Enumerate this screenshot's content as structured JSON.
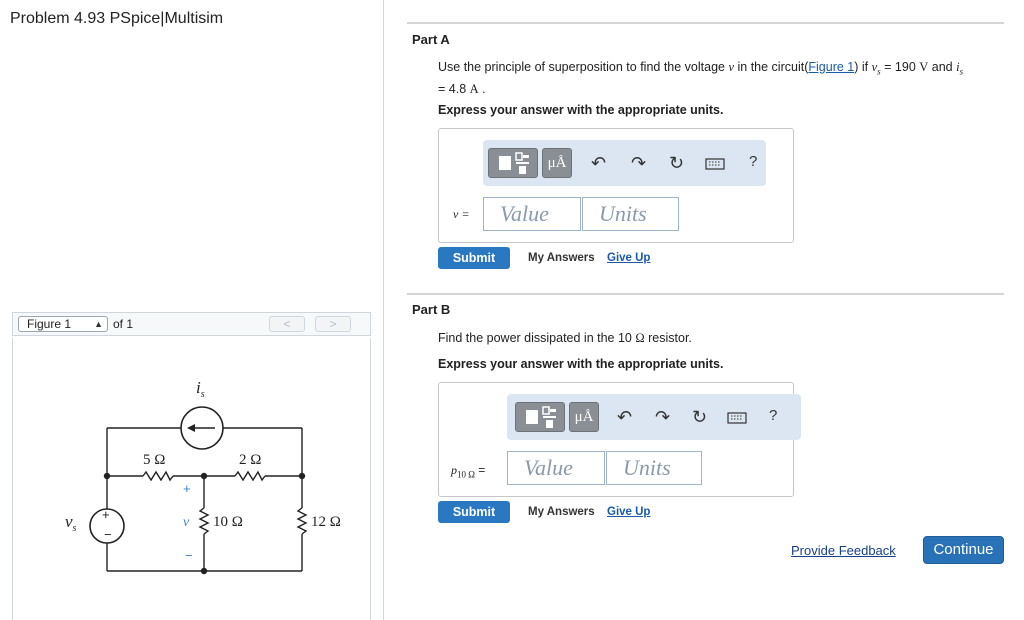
{
  "problem": {
    "title": "Problem 4.93 PSpice|Multisim"
  },
  "figure": {
    "selector_value": "Figure 1",
    "of_label": "of 1",
    "prev": "<",
    "next": ">",
    "circuit": {
      "source_current": "i",
      "source_current_sub": "s",
      "voltage_source": "v",
      "voltage_source_sub": "s",
      "r1": "5 Ω",
      "r2": "2 Ω",
      "r3": "10 Ω",
      "r4": "12 Ω",
      "v_label": "v",
      "plus": "+",
      "minus": "−"
    }
  },
  "partA": {
    "title": "Part A",
    "q_pre": "Use the principle of superposition to find the voltage ",
    "q_var": "v",
    "q_mid": " in the circuit(",
    "q_link": "Figure 1",
    "q_post": ") if ",
    "q_vs": "v",
    "q_vs_sub": "s",
    "q_eq": " = 190 ",
    "q_unitV": "V",
    "q_and": " and ",
    "q_is": "i",
    "q_is_sub": "s",
    "q_line2": "= 4.8 ",
    "q_unitA": "A",
    "q_end": " .",
    "instruction": "Express your answer with the appropriate units.",
    "var_label": "v =",
    "value_placeholder": "Value",
    "units_placeholder": "Units",
    "submit": "Submit",
    "my_answers": "My Answers",
    "give_up": "Give Up"
  },
  "partB": {
    "title": "Part B",
    "q_pre": "Find the power dissipated in the 10 ",
    "q_omega": "Ω",
    "q_post": " resistor.",
    "instruction": "Express your answer with the appropriate units.",
    "var_label": "p",
    "var_sub": "10 Ω",
    "var_eq": " =",
    "value_placeholder": "Value",
    "units_placeholder": "Units",
    "submit": "Submit",
    "my_answers": "My Answers",
    "give_up": "Give Up"
  },
  "toolbar": {
    "mu_label": "μÅ",
    "help_label": "?"
  },
  "footer": {
    "feedback": "Provide Feedback",
    "continue": "Continue"
  }
}
